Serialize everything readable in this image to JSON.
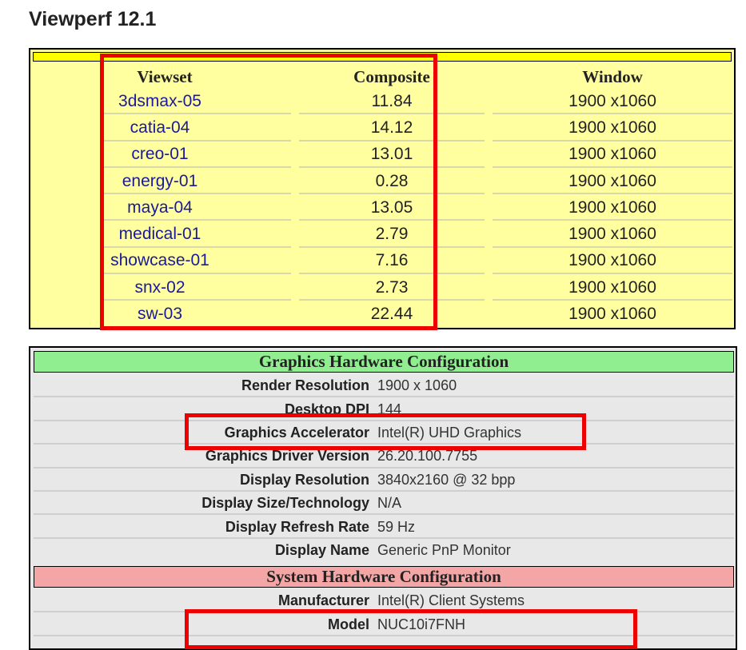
{
  "page": {
    "title": "Viewperf 12.1"
  },
  "results": {
    "headers": [
      "Viewset",
      "Composite",
      "Window"
    ],
    "rows": [
      [
        "3dsmax-05",
        "11.84",
        "1900 x1060"
      ],
      [
        "catia-04",
        "14.12",
        "1900 x1060"
      ],
      [
        "creo-01",
        "13.01",
        "1900 x1060"
      ],
      [
        "energy-01",
        "0.28",
        "1900 x1060"
      ],
      [
        "maya-04",
        "13.05",
        "1900 x1060"
      ],
      [
        "medical-01",
        "2.79",
        "1900 x1060"
      ],
      [
        "showcase-01",
        "7.16",
        "1900 x1060"
      ],
      [
        "snx-02",
        "2.73",
        "1900 x1060"
      ],
      [
        "sw-03",
        "22.44",
        "1900 x1060"
      ]
    ]
  },
  "graphics": {
    "header": "Graphics Hardware Configuration",
    "rows": [
      [
        "Render Resolution",
        "1900 x 1060"
      ],
      [
        "Desktop DPI",
        "144"
      ],
      [
        "Graphics Accelerator",
        "Intel(R) UHD Graphics"
      ],
      [
        "Graphics Driver Version",
        "26.20.100.7755"
      ],
      [
        "Display Resolution",
        "3840x2160 @ 32 bpp"
      ],
      [
        "Display Size/Technology",
        "N/A"
      ],
      [
        "Display Refresh Rate",
        "59 Hz"
      ],
      [
        "Display Name",
        "Generic PnP Monitor"
      ]
    ]
  },
  "system": {
    "header": "System Hardware Configuration",
    "rows": [
      [
        "Manufacturer",
        "Intel(R) Client Systems"
      ],
      [
        "Model",
        "NUC10i7FNH"
      ]
    ]
  },
  "colors": {
    "highlight": "#ee0000",
    "results_bg": "#ffffa0",
    "graphics_header": "#90ee90",
    "system_header": "#f4a6a6"
  }
}
